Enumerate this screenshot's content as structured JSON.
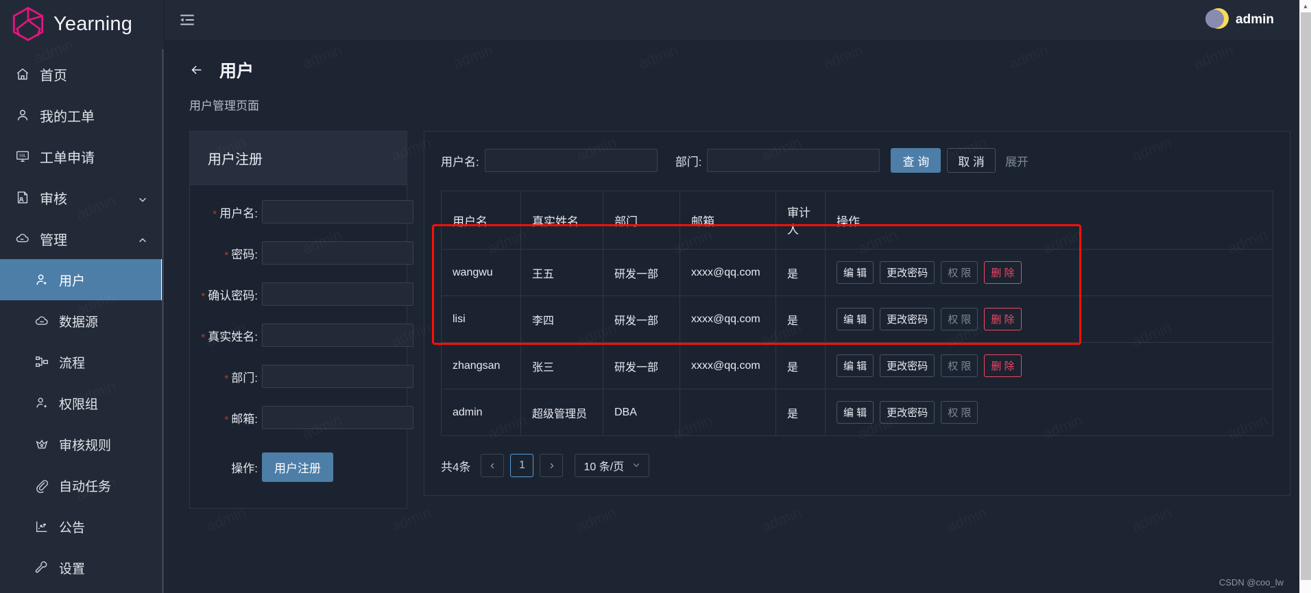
{
  "brand": {
    "name": "Yearning",
    "logo_icon": "cube-hexagon-logo",
    "accent": "#e5147f"
  },
  "topbar": {
    "menu_icon": "menu-fold-icon",
    "user": {
      "name": "admin",
      "avatar_icon": "moon-avatar"
    }
  },
  "sidebar": {
    "items": [
      {
        "label": "首页",
        "icon": "home-icon",
        "type": "item",
        "active": false
      },
      {
        "label": "我的工单",
        "icon": "user-icon",
        "type": "item",
        "active": false
      },
      {
        "label": "工单申请",
        "icon": "sql-console-icon",
        "type": "item",
        "active": false
      },
      {
        "label": "审核",
        "icon": "audit-doc-icon",
        "type": "group",
        "expanded": false,
        "arrow": "chevron-down-icon"
      },
      {
        "label": "管理",
        "icon": "cloud-icon",
        "type": "group",
        "expanded": true,
        "arrow": "chevron-up-icon"
      },
      {
        "label": "用户",
        "icon": "user-add-icon",
        "type": "sub",
        "active": true
      },
      {
        "label": "数据源",
        "icon": "database-cloud-icon",
        "type": "sub",
        "active": false
      },
      {
        "label": "流程",
        "icon": "flow-branch-icon",
        "type": "sub",
        "active": false
      },
      {
        "label": "权限组",
        "icon": "user-group-icon",
        "type": "sub",
        "active": false
      },
      {
        "label": "审核规则",
        "icon": "crown-icon",
        "type": "sub",
        "active": false
      },
      {
        "label": "自动任务",
        "icon": "paperclip-icon",
        "type": "sub",
        "active": false
      },
      {
        "label": "公告",
        "icon": "chart-icon",
        "type": "sub",
        "active": false
      },
      {
        "label": "设置",
        "icon": "wrench-icon",
        "type": "sub",
        "active": false
      }
    ]
  },
  "page": {
    "back_icon": "arrow-left-icon",
    "title": "用户",
    "subtitle": "用户管理页面"
  },
  "register_card": {
    "title": "用户注册",
    "fields": [
      {
        "label": "用户名:",
        "required": true,
        "value": "",
        "placeholder": ""
      },
      {
        "label": "密码:",
        "required": true,
        "value": "",
        "placeholder": ""
      },
      {
        "label": "确认密码:",
        "required": true,
        "value": "",
        "placeholder": ""
      },
      {
        "label": "真实姓名:",
        "required": true,
        "value": "",
        "placeholder": ""
      },
      {
        "label": "部门:",
        "required": true,
        "value": "",
        "placeholder": ""
      },
      {
        "label": "邮箱:",
        "required": true,
        "value": "",
        "placeholder": ""
      }
    ],
    "submit_label_prefix": "操作:",
    "submit_label": "用户注册"
  },
  "filter": {
    "username_label": "用户名:",
    "username_value": "",
    "dept_label": "部门:",
    "dept_value": "",
    "search_label": "查 询",
    "cancel_label": "取 消",
    "expand_label": "展开"
  },
  "table": {
    "headers": [
      "用户名",
      "真实姓名",
      "部门",
      "邮箱",
      "审计人",
      "操作"
    ],
    "rows": [
      {
        "username": "wangwu",
        "realname": "王五",
        "dept": "研发一部",
        "email": "xxxx@qq.com",
        "auditor": "是",
        "actions": [
          {
            "label": "编 辑",
            "style": "normal"
          },
          {
            "label": "更改密码",
            "style": "normal"
          },
          {
            "label": "权 限",
            "style": "ghost"
          },
          {
            "label": "删 除",
            "style": "danger"
          }
        ]
      },
      {
        "username": "lisi",
        "realname": "李四",
        "dept": "研发一部",
        "email": "xxxx@qq.com",
        "auditor": "是",
        "actions": [
          {
            "label": "编 辑",
            "style": "normal"
          },
          {
            "label": "更改密码",
            "style": "normal"
          },
          {
            "label": "权 限",
            "style": "ghost"
          },
          {
            "label": "删 除",
            "style": "danger"
          }
        ]
      },
      {
        "username": "zhangsan",
        "realname": "张三",
        "dept": "研发一部",
        "email": "xxxx@qq.com",
        "auditor": "是",
        "actions": [
          {
            "label": "编 辑",
            "style": "normal"
          },
          {
            "label": "更改密码",
            "style": "normal"
          },
          {
            "label": "权 限",
            "style": "ghost"
          },
          {
            "label": "删 除",
            "style": "danger"
          }
        ]
      },
      {
        "username": "admin",
        "realname": "超级管理员",
        "dept": "DBA",
        "email": "",
        "auditor": "是",
        "actions": [
          {
            "label": "编 辑",
            "style": "normal"
          },
          {
            "label": "更改密码",
            "style": "normal"
          },
          {
            "label": "权 限",
            "style": "ghost"
          }
        ]
      }
    ],
    "highlight_color": "#fb1005"
  },
  "pagination": {
    "total_text": "共4条",
    "prev_icon": "chevron-left-icon",
    "current_page": "1",
    "next_icon": "chevron-right-icon",
    "page_size": "10 条/页",
    "page_size_icon": "chevron-down-icon"
  },
  "watermark": {
    "text": "admin"
  },
  "footer_mark": "CSDN @coo_lw"
}
